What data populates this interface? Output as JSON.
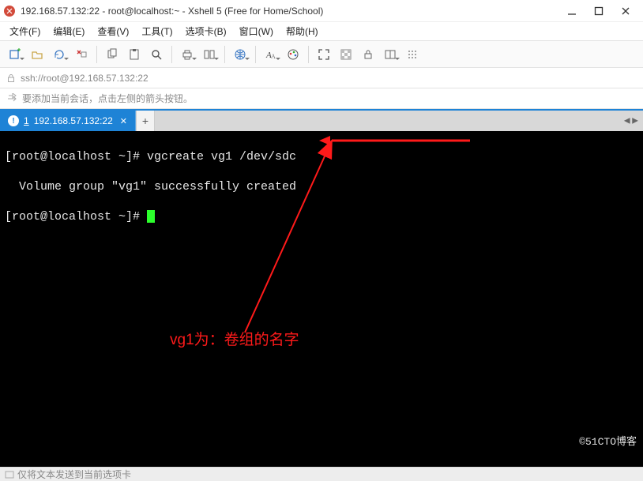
{
  "window": {
    "title": "192.168.57.132:22 - root@localhost:~ - Xshell 5 (Free for Home/School)"
  },
  "menu": {
    "file": "文件(F)",
    "edit": "编辑(E)",
    "view": "查看(V)",
    "tools": "工具(T)",
    "tabs": "选项卡(B)",
    "window": "窗口(W)",
    "help": "帮助(H)"
  },
  "address": {
    "url": "ssh://root@192.168.57.132:22"
  },
  "hint": {
    "text": "要添加当前会话，点击左侧的箭头按钮。"
  },
  "tab": {
    "index": "1",
    "label": "192.168.57.132:22"
  },
  "terminal": {
    "line1_prefix": "[root@localhost ~]# ",
    "line1_cmd": "vgcreate vg1 /dev/sdc",
    "line2": "  Volume group \"vg1\" successfully created",
    "line3_prefix": "[root@localhost ~]# "
  },
  "annotation": {
    "text": "vg1为：卷组的名字"
  },
  "watermark": "©51CTO博客",
  "status": {
    "text": "仅将文本发送到当前选项卡"
  },
  "icons": {
    "new": "new-session",
    "open": "open",
    "reconnect": "reconnect",
    "disconnect": "disconnect",
    "copy": "copy",
    "paste": "paste",
    "search": "search",
    "print": "print",
    "properties": "properties",
    "globe": "globe",
    "font": "font",
    "color": "color-scheme",
    "fullscreen": "fullscreen",
    "transparent": "transparent",
    "lockscroll": "lock-scroll",
    "dotted": "dotted"
  }
}
